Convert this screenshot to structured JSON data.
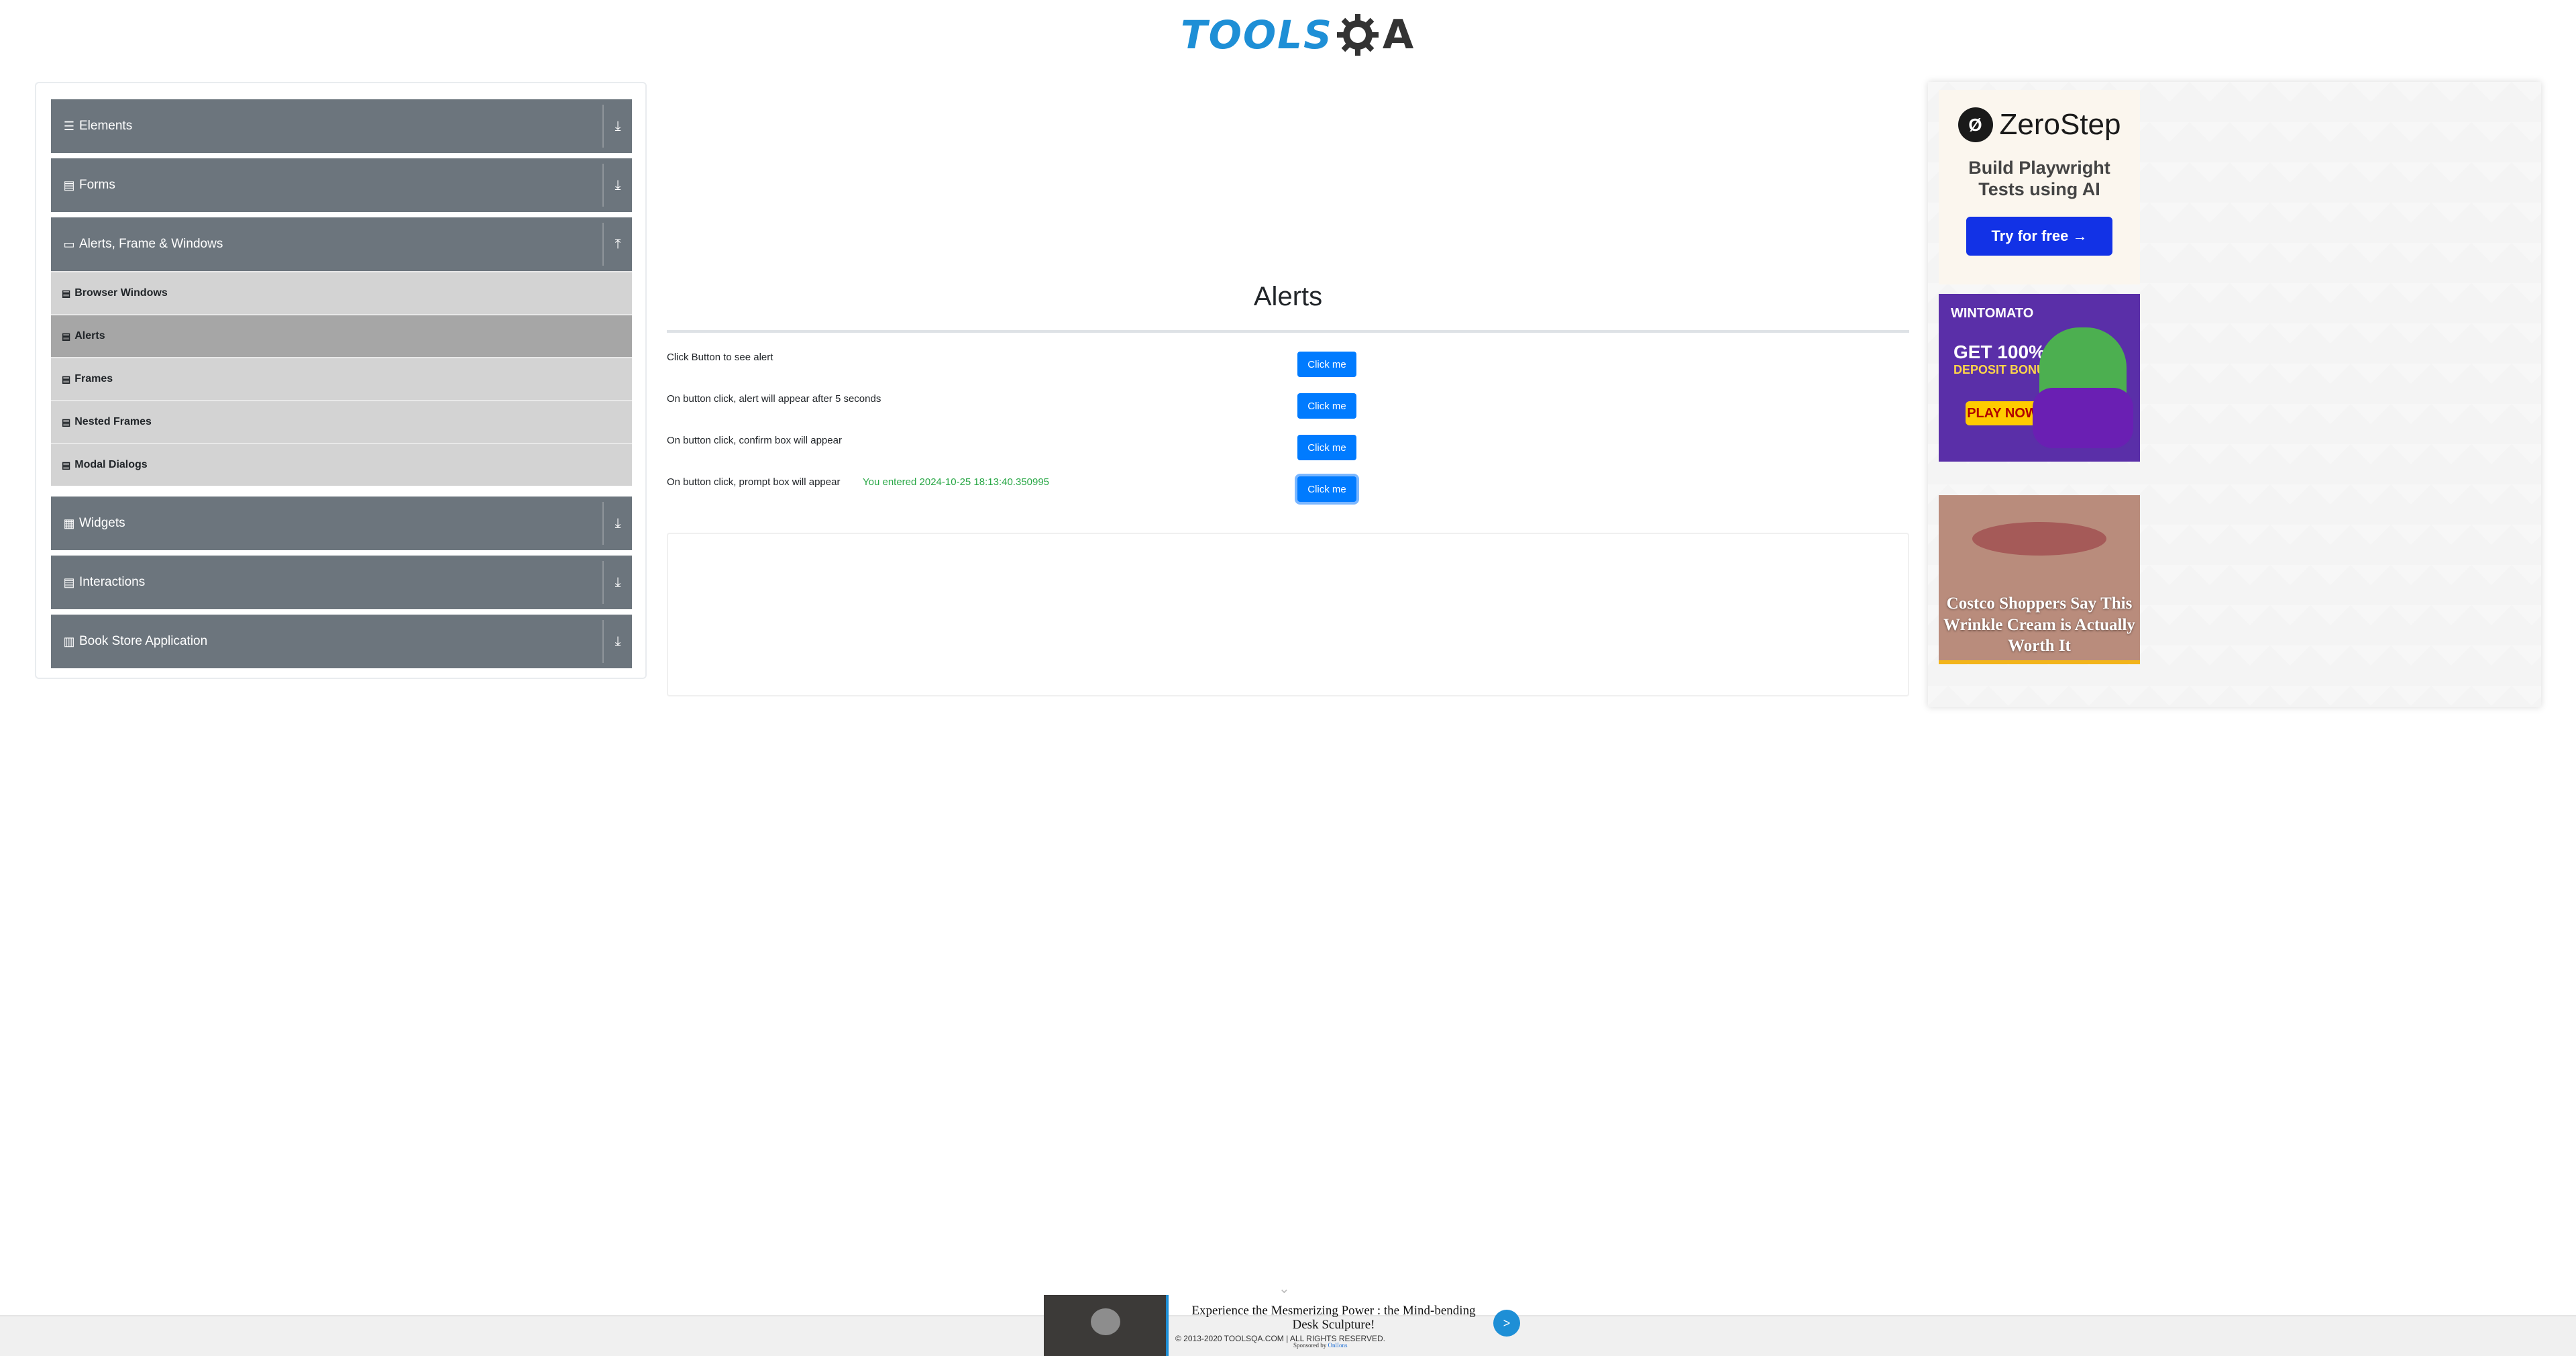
{
  "header": {
    "logo_text_left": "TOOLS",
    "logo_text_right": "A",
    "logo_icon": "gear-q-icon"
  },
  "sidebar": {
    "groups": [
      {
        "label": "Elements",
        "icon": "bars-icon",
        "toggle": "⤓"
      },
      {
        "label": "Forms",
        "icon": "doc-icon",
        "toggle": "⤓"
      },
      {
        "label": "Alerts, Frame & Windows",
        "icon": "window-icon",
        "toggle": "⤒",
        "items": [
          {
            "label": "Browser Windows",
            "icon": "doc-icon"
          },
          {
            "label": "Alerts",
            "icon": "doc-icon",
            "active": true
          },
          {
            "label": "Frames",
            "icon": "doc-icon"
          },
          {
            "label": "Nested Frames",
            "icon": "doc-icon"
          },
          {
            "label": "Modal Dialogs",
            "icon": "doc-icon"
          }
        ]
      },
      {
        "label": "Widgets",
        "icon": "grid-icon",
        "toggle": "⤓"
      },
      {
        "label": "Interactions",
        "icon": "doc-icon",
        "toggle": "⤓"
      },
      {
        "label": "Book Store Application",
        "icon": "book-icon",
        "toggle": "⤓"
      }
    ]
  },
  "main": {
    "title": "Alerts",
    "rows": [
      {
        "label": "Click Button to see alert",
        "button": "Click me",
        "result": ""
      },
      {
        "label": "On button click, alert will appear after 5 seconds",
        "button": "Click me",
        "result": ""
      },
      {
        "label": "On button click, confirm box will appear",
        "button": "Click me",
        "result": ""
      },
      {
        "label": "On button click, prompt box will appear",
        "button": "Click me",
        "result": "You entered 2024-10-25 18:13:40.350995"
      }
    ]
  },
  "ads": {
    "zerostep": {
      "brand": "ZeroStep",
      "tagline_1": "Build Playwright",
      "tagline_2": "Tests using AI",
      "cta": "Try for free →"
    },
    "wintomato": {
      "brand": "WINTOMATO",
      "promo_1": "GET 100%",
      "promo_2": "DEPOSIT BONUS",
      "cta": "PLAY NOW"
    },
    "costco": {
      "headline": "Costco Shoppers Say This Wrinkle Cream is Actually Worth It"
    }
  },
  "footer": {
    "copyright": "© 2013-2020 TOOLSQA.COM | ALL RIGHTS RESERVED.",
    "sponsored_headline": "Experience the Mesmerizing Power : the Mind-bending Desk Sculpture!",
    "sponsored_by": "Sponsored by",
    "sponsor_name": "OnlIons",
    "go_label": ">"
  },
  "colors": {
    "accent": "#007bff",
    "sidebar_header": "#6c757d",
    "sidebar_item": "#d3d3d3",
    "sidebar_item_active": "#a6a6a6",
    "result_text": "#28a745"
  }
}
